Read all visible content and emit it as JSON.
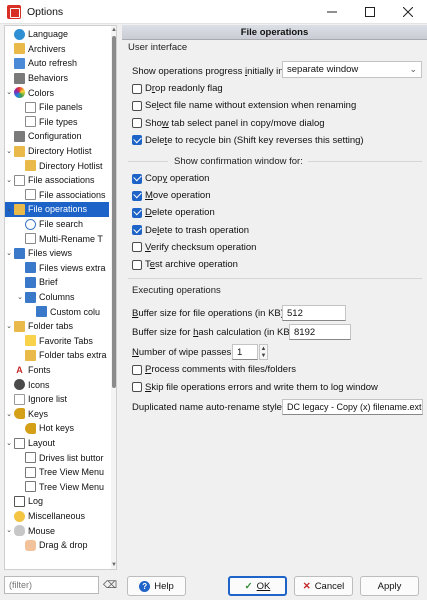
{
  "window": {
    "title": "Options"
  },
  "tree": {
    "items": [
      {
        "label": "Language",
        "icon": "globe-icon"
      },
      {
        "label": "Archivers",
        "icon": "archive-icon"
      },
      {
        "label": "Auto refresh",
        "icon": "refresh-icon"
      },
      {
        "label": "Behaviors",
        "icon": "behaviors-icon"
      },
      {
        "label": "Colors",
        "icon": "palette-icon"
      },
      {
        "label": "File panels",
        "icon": "doc-icon"
      },
      {
        "label": "File types",
        "icon": "doc-icon"
      },
      {
        "label": "Configuration",
        "icon": "config-icon"
      },
      {
        "label": "Directory Hotlist",
        "icon": "folder-icon"
      },
      {
        "label": "Directory Hotlist",
        "icon": "folder-icon"
      },
      {
        "label": "File associations",
        "icon": "file-assoc-icon"
      },
      {
        "label": "File associations",
        "icon": "file-assoc-icon"
      },
      {
        "label": "File operations",
        "icon": "folder-icon"
      },
      {
        "label": "File search",
        "icon": "search-icon"
      },
      {
        "label": "Multi-Rename T",
        "icon": "rename-icon"
      },
      {
        "label": "Files views",
        "icon": "view-icon"
      },
      {
        "label": "Files views extra",
        "icon": "view-icon"
      },
      {
        "label": "Brief",
        "icon": "view-icon"
      },
      {
        "label": "Columns",
        "icon": "columns-icon"
      },
      {
        "label": "Custom colu",
        "icon": "columns-icon"
      },
      {
        "label": "Folder tabs",
        "icon": "folder-icon"
      },
      {
        "label": "Favorite Tabs",
        "icon": "star-icon"
      },
      {
        "label": "Folder tabs extra",
        "icon": "folder-icon"
      },
      {
        "label": "Fonts",
        "icon": "font-icon"
      },
      {
        "label": "Icons",
        "icon": "icons-icon"
      },
      {
        "label": "Ignore list",
        "icon": "ignore-icon"
      },
      {
        "label": "Keys",
        "icon": "key-icon"
      },
      {
        "label": "Hot keys",
        "icon": "key-icon"
      },
      {
        "label": "Layout",
        "icon": "layout-icon"
      },
      {
        "label": "Drives list buttor",
        "icon": "layout-icon"
      },
      {
        "label": "Tree View Menu",
        "icon": "layout-icon"
      },
      {
        "label": "Tree View Menu",
        "icon": "layout-icon"
      },
      {
        "label": "Log",
        "icon": "log-icon"
      },
      {
        "label": "Miscellaneous",
        "icon": "misc-icon"
      },
      {
        "label": "Mouse",
        "icon": "mouse-icon"
      },
      {
        "label": "Drag & drop",
        "icon": "hand-icon"
      }
    ],
    "filter_placeholder": "(filter)"
  },
  "panel": {
    "header": "File operations",
    "ui_group": "User interface",
    "progress_label_pre": "Show operations progress ",
    "progress_label_u": "i",
    "progress_label_post": "nitially in",
    "progress_value": "separate window",
    "checks_ui": [
      {
        "pre": "D",
        "u": "r",
        "post": "op readonly flag",
        "checked": false
      },
      {
        "pre": "Se",
        "u": "l",
        "post": "ect file name without extension when renaming",
        "checked": false
      },
      {
        "pre": "Sho",
        "u": "w",
        "post": " tab select panel in copy/move dialog",
        "checked": false
      },
      {
        "pre": "Dele",
        "u": "t",
        "post": "e to recycle bin (Shift key reverses this setting)",
        "checked": true
      }
    ],
    "confirm_group": "Show confirmation window for:",
    "checks_confirm": [
      {
        "pre": "Cop",
        "u": "y",
        "post": " operation",
        "checked": true
      },
      {
        "pre": "",
        "u": "M",
        "post": "ove operation",
        "checked": true
      },
      {
        "pre": "",
        "u": "D",
        "post": "elete operation",
        "checked": true
      },
      {
        "pre": "De",
        "u": "l",
        "post": "ete to trash operation",
        "checked": true
      },
      {
        "pre": "",
        "u": "V",
        "post": "erify checksum operation",
        "checked": false
      },
      {
        "pre": "T",
        "u": "e",
        "post": "st archive operation",
        "checked": false
      }
    ],
    "exec_group": "Executing operations",
    "buffer_label_pre": "",
    "buffer_label_u": "B",
    "buffer_label_post": "uffer size for file operations (in KB):",
    "buffer_value": "512",
    "hash_label_pre": "Buffer size for ",
    "hash_label_u": "h",
    "hash_label_post": "ash calculation (in KB):",
    "hash_value": "8192",
    "wipe_label_pre": "",
    "wipe_label_u": "N",
    "wipe_label_post": "umber of wipe passes:",
    "wipe_value": "1",
    "checks_exec": [
      {
        "pre": "",
        "u": "P",
        "post": "rocess comments with files/folders",
        "checked": false
      },
      {
        "pre": "",
        "u": "S",
        "post": "kip file operations errors and write them to log window",
        "checked": false
      }
    ],
    "dup_label": "Duplicated name auto-rename style:",
    "dup_value": "DC legacy - Copy (x) filename.ext"
  },
  "buttons": {
    "help": "Help",
    "ok": "OK",
    "cancel": "Cancel",
    "apply": "Apply"
  }
}
